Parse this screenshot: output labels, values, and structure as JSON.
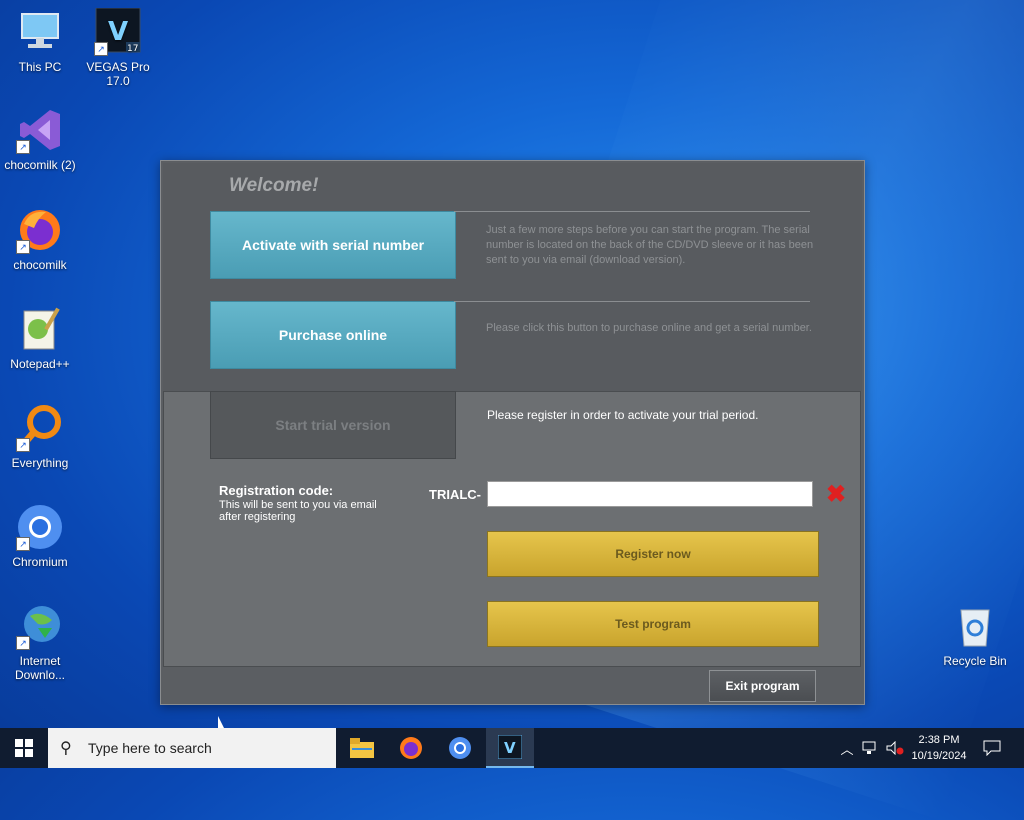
{
  "desktop": {
    "icons": [
      {
        "label": "This PC"
      },
      {
        "label": "VEGAS Pro 17.0"
      },
      {
        "label": "chocomilk (2)"
      },
      {
        "label": "chocomilk"
      },
      {
        "label": "Notepad++"
      },
      {
        "label": "Everything"
      },
      {
        "label": "Chromium"
      },
      {
        "label": "Internet Downlo..."
      },
      {
        "label": "Recycle Bin"
      }
    ]
  },
  "dialog": {
    "welcome": "Welcome!",
    "activate_label": "Activate with serial number",
    "activate_desc": "Just a few more steps before you can start the program. The serial number is located on the back of the CD/DVD sleeve or it has been sent to you via email (download version).",
    "purchase_label": "Purchase online",
    "purchase_desc": "Please click this button to purchase online and get a serial number.",
    "trial_label": "Start trial version",
    "trial_msg": "Please register in order to activate your trial period.",
    "reg_label": "Registration code:",
    "reg_sub": "This will be sent to you via email after registering",
    "reg_prefix": "TRIALC-",
    "reg_value": "",
    "register_label": "Register now",
    "test_label": "Test program",
    "exit_label": "Exit program"
  },
  "taskbar": {
    "search_placeholder": "Type here to search",
    "time": "2:38 PM",
    "date": "10/19/2024"
  }
}
